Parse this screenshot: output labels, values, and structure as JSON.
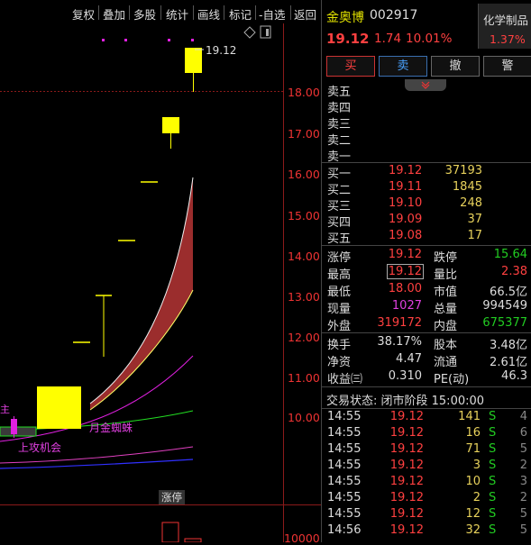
{
  "toolbar": {
    "items": [
      "复权",
      "叠加",
      "多股",
      "统计",
      "画线",
      "标记",
      "-自选",
      "返回"
    ]
  },
  "chart": {
    "price_ticks": [
      "18.00",
      "17.00",
      "16.00",
      "15.00",
      "14.00",
      "13.00",
      "12.00",
      "11.00",
      "10.00"
    ],
    "vol_tick": "10000",
    "high_label": "19.12",
    "annotations": {
      "golden_spider": "月金蜘蛛",
      "attack_chance": "上攻机会",
      "limit_up_bar": "涨停",
      "left_fragment": "主"
    },
    "colors": {
      "candle": "#ffff00",
      "band_fill": "#9b2d2d",
      "band_upper": "#ffff66",
      "ma_magenta": "#e020e0",
      "ma_green": "#22dd22",
      "ma_pink": "#e040c0",
      "ma_blue": "#3030ff"
    }
  },
  "stock": {
    "name": "金奥博",
    "code": "002917",
    "price": "19.12",
    "change": "1.74",
    "change_pct": "10.01%",
    "sector": "化学制品",
    "sector_pct": "1.37%"
  },
  "buttons": {
    "buy": "买",
    "sell": "卖",
    "cancel": "撤",
    "alert": "警"
  },
  "sell_levels": [
    "卖五",
    "卖四",
    "卖三",
    "卖二",
    "卖一"
  ],
  "buy_levels": [
    {
      "label": "买一",
      "price": "19.12",
      "vol": "37193"
    },
    {
      "label": "买二",
      "price": "19.11",
      "vol": "1845"
    },
    {
      "label": "买三",
      "price": "19.10",
      "vol": "248"
    },
    {
      "label": "买四",
      "price": "19.09",
      "vol": "37"
    },
    {
      "label": "买五",
      "price": "19.08",
      "vol": "17"
    }
  ],
  "stats": {
    "zhangting_label": "涨停",
    "zhangting": "19.12",
    "dieting_label": "跌停",
    "dieting": "15.64",
    "high_label": "最高",
    "high": "19.12",
    "liangbi_label": "量比",
    "liangbi": "2.38",
    "low_label": "最低",
    "low": "18.00",
    "shizhi_label": "市值",
    "shizhi": "66.5亿",
    "xianliang_label": "现量",
    "xianliang": "1027",
    "zongliang_label": "总量",
    "zongliang": "994549",
    "waipan_label": "外盘",
    "waipan": "319172",
    "neipan_label": "内盘",
    "neipan": "675377",
    "huanshou_label": "换手",
    "huanshou": "38.17%",
    "guben_label": "股本",
    "guben": "3.48亿",
    "jingzi_label": "净资",
    "jingzi": "4.47",
    "liutong_label": "流通",
    "liutong": "2.61亿",
    "shouyi_label": "收益㈢",
    "shouyi": "0.310",
    "pe_label": "PE(动)",
    "pe": "46.3"
  },
  "trade_status": "交易状态: 闭市阶段 15:00:00",
  "ticks": [
    {
      "time": "14:55",
      "price": "19.12",
      "vol": "141",
      "side": "S",
      "n": "4"
    },
    {
      "time": "14:55",
      "price": "19.12",
      "vol": "16",
      "side": "S",
      "n": "6"
    },
    {
      "time": "14:55",
      "price": "19.12",
      "vol": "71",
      "side": "S",
      "n": "5"
    },
    {
      "time": "14:55",
      "price": "19.12",
      "vol": "3",
      "side": "S",
      "n": "2"
    },
    {
      "time": "14:55",
      "price": "19.12",
      "vol": "10",
      "side": "S",
      "n": "3"
    },
    {
      "time": "14:55",
      "price": "19.12",
      "vol": "2",
      "side": "S",
      "n": "2"
    },
    {
      "time": "14:55",
      "price": "19.12",
      "vol": "12",
      "side": "S",
      "n": "5"
    },
    {
      "time": "14:56",
      "price": "19.12",
      "vol": "32",
      "side": "S",
      "n": "5"
    }
  ]
}
